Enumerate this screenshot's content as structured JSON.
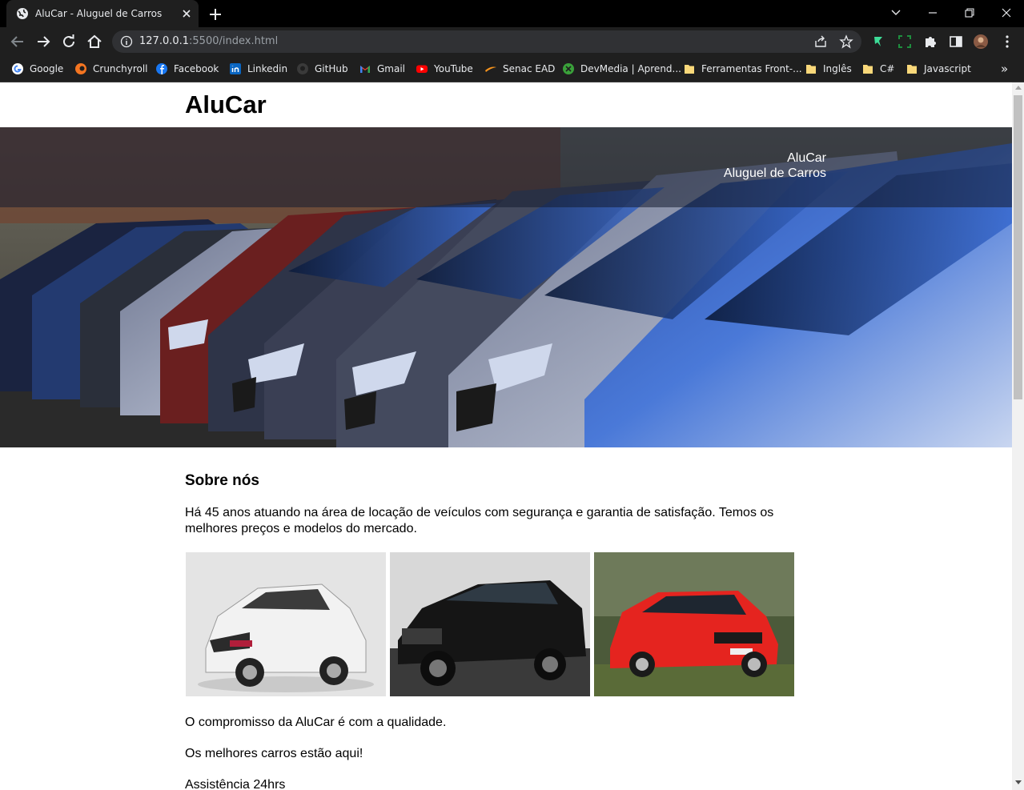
{
  "browser": {
    "tab_title": "AluCar - Aluguel de Carros",
    "url_host": "127.0.0.1",
    "url_path": ":5500/index.html",
    "bookmarks": [
      {
        "label": "Google",
        "icon": "google-icon"
      },
      {
        "label": "Crunchyroll",
        "icon": "crunchyroll-icon"
      },
      {
        "label": "Facebook",
        "icon": "facebook-icon"
      },
      {
        "label": "Linkedin",
        "icon": "linkedin-icon"
      },
      {
        "label": "GitHub",
        "icon": "github-icon"
      },
      {
        "label": "Gmail",
        "icon": "gmail-icon"
      },
      {
        "label": "YouTube",
        "icon": "youtube-icon"
      },
      {
        "label": "Senac EAD",
        "icon": "senac-icon"
      },
      {
        "label": "DevMedia | Aprend...",
        "icon": "devmedia-icon"
      },
      {
        "label": "Ferramentas Front-...",
        "icon": "folder-icon"
      },
      {
        "label": "Inglês",
        "icon": "folder-icon"
      },
      {
        "label": "C#",
        "icon": "folder-icon"
      },
      {
        "label": "Javascript",
        "icon": "folder-icon"
      }
    ],
    "bookmarks_overflow": "»"
  },
  "page": {
    "site_title": "AluCar",
    "hero": {
      "caption_line1": "AluCar",
      "caption_line2": "Aluguel de Carros"
    },
    "about": {
      "title": "Sobre nós",
      "text": "Há 45 anos atuando na área de locação de veículos com segurança e garantia de satisfação. Temos os melhores preços e modelos do mercado."
    },
    "gallery": [
      {
        "name": "white-hatchback-photo",
        "color": "#e9e9e9"
      },
      {
        "name": "black-pickup-photo",
        "color": "#1c1c1c"
      },
      {
        "name": "red-hatchback-photo",
        "color": "#e5241f"
      }
    ],
    "paragraphs": [
      "O compromisso da AluCar é com a qualidade.",
      "Os melhores carros estão aqui!",
      "Assistência 24hrs"
    ]
  },
  "colors": {
    "chrome_dark": "#1f1f1f",
    "tabstrip": "#000000",
    "omnibox": "#303134"
  }
}
